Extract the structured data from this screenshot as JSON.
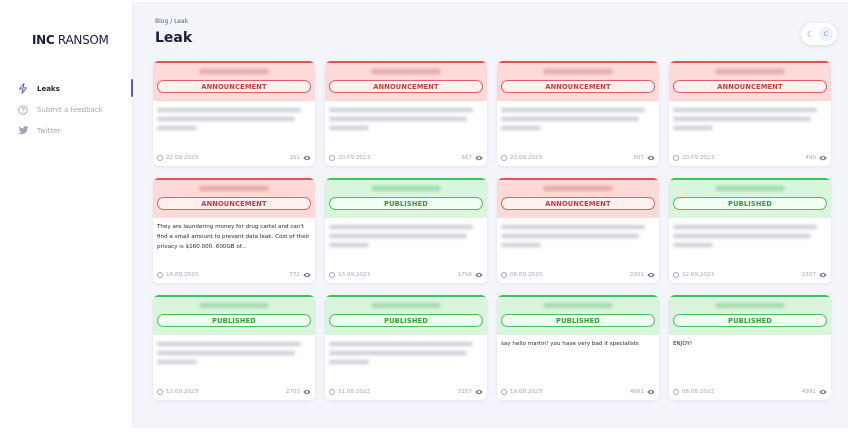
{
  "app": {
    "logo_bold": "INC",
    "logo_rest": " RANSOM"
  },
  "sidebar": {
    "items": [
      {
        "label": "Leaks",
        "icon": "lightning-icon",
        "active": true
      },
      {
        "label": "Submit a feedback",
        "icon": "question-icon",
        "active": false
      },
      {
        "label": "Twitter",
        "icon": "twitter-icon",
        "active": false
      }
    ]
  },
  "header": {
    "breadcrumb": "Blog / Leak",
    "title": "Leak",
    "theme_toggle_icon": "moon-icon",
    "theme_knob": "C"
  },
  "colors": {
    "accent": "#4f5bd5",
    "announcement": "#d8373a",
    "published": "#25a23c"
  },
  "cards": [
    {
      "status": "ANNOUNCEMENT",
      "variant": "red",
      "desc": "",
      "date": "22.09.2023",
      "views": "151"
    },
    {
      "status": "ANNOUNCEMENT",
      "variant": "red",
      "desc": "",
      "date": "20.09.2023",
      "views": "567"
    },
    {
      "status": "ANNOUNCEMENT",
      "variant": "red",
      "desc": "",
      "date": "20.09.2023",
      "views": "507"
    },
    {
      "status": "ANNOUNCEMENT",
      "variant": "red",
      "desc": "",
      "date": "20.09.2023",
      "views": "490"
    },
    {
      "status": "ANNOUNCEMENT",
      "variant": "red",
      "desc": "They are laundering money for drug cartel and can't find a small amount to prevent data leak. Cost of their privacy is $160.000. 600GB of...",
      "date": "16.09.2023",
      "views": "772"
    },
    {
      "status": "PUBLISHED",
      "variant": "green",
      "desc": "",
      "date": "13.09.2023",
      "views": "1756"
    },
    {
      "status": "ANNOUNCEMENT",
      "variant": "red",
      "desc": "",
      "date": "06.09.2023",
      "views": "2301"
    },
    {
      "status": "PUBLISHED",
      "variant": "green",
      "desc": "",
      "date": "12.09.2023",
      "views": "2307"
    },
    {
      "status": "PUBLISHED",
      "variant": "green",
      "desc": "",
      "date": "12.09.2023",
      "views": "2703"
    },
    {
      "status": "PUBLISHED",
      "variant": "green",
      "desc": "",
      "date": "31.08.2023",
      "views": "3157"
    },
    {
      "status": "PUBLISHED",
      "variant": "green",
      "desc": "say hello martin! you have very bad it specialists",
      "date": "19.08.2023",
      "views": "4661"
    },
    {
      "status": "PUBLISHED",
      "variant": "green",
      "desc": "ENJOY!",
      "date": "06.08.2023",
      "views": "4991"
    }
  ]
}
